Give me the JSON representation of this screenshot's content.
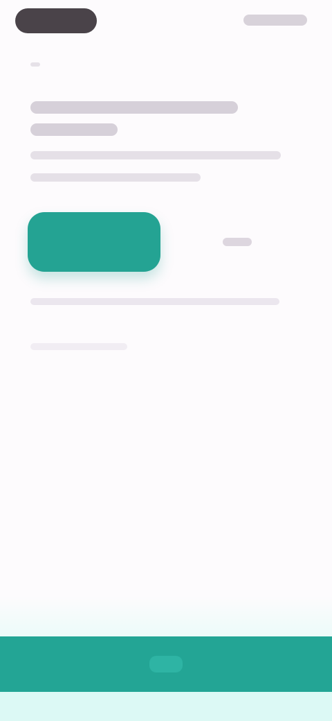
{
  "status_bar": {},
  "content": {
    "title": "",
    "description": "",
    "primary_button_label": "",
    "secondary_link_label": "",
    "note": ""
  },
  "colors": {
    "accent": "#23a595",
    "background": "#fdfbfd",
    "bottom_tint": "#dcf9f5"
  },
  "icons": {
    "back": "back-arrow-icon",
    "home_handle": "home-handle-icon"
  }
}
